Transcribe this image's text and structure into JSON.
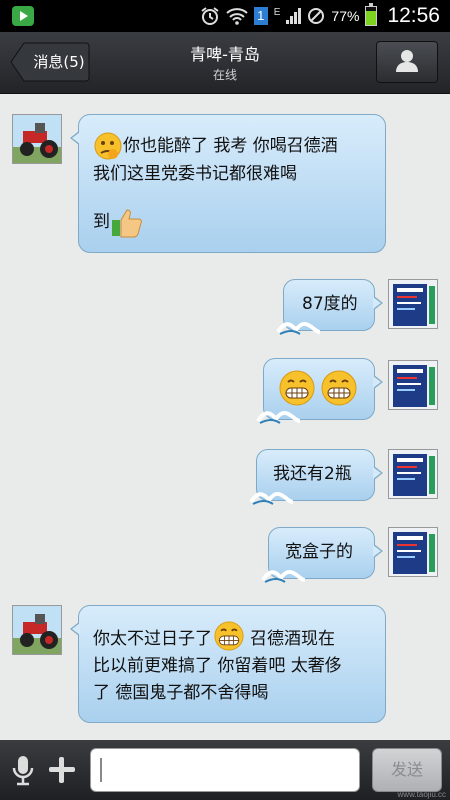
{
  "status_bar": {
    "sim_number": "1",
    "network_type": "E",
    "battery_percent": "77%",
    "battery_level": 0.77,
    "time": "12:56",
    "icons": [
      "app-play-icon",
      "alarm-icon",
      "wifi-icon",
      "sim-icon",
      "signal-icon",
      "no-sim-icon",
      "battery-icon"
    ]
  },
  "header": {
    "back_label": "消息(5)",
    "title": "青啤-青岛",
    "subtitle": "在线",
    "profile_icon": "person-icon"
  },
  "messages": [
    {
      "side": "left",
      "avatar": "tractor-avatar",
      "lines": [
        "你也能醉了 我考 你喝召德酒",
        "我们这里党委书记都很难喝",
        "",
        "到"
      ],
      "emoji": [
        "thinking-emoji",
        "thumbs-up-emoji"
      ]
    },
    {
      "side": "right",
      "avatar": "poster-avatar",
      "text": "87度的"
    },
    {
      "side": "right",
      "avatar": "poster-avatar",
      "text": "",
      "emoji": [
        "grin-emoji",
        "grin-emoji"
      ]
    },
    {
      "side": "right",
      "avatar": "poster-avatar",
      "text": "我还有2瓶"
    },
    {
      "side": "right",
      "avatar": "poster-avatar",
      "text": "宽盒子的"
    },
    {
      "side": "left",
      "avatar": "tractor-avatar",
      "line1_a": "你太不过日子了",
      "line1_b": "召德酒现在",
      "line2": "比以前更难搞了 你留着吧 太奢侈",
      "line3": "了 德国鬼子都不舍得喝",
      "emoji": [
        "grin-emoji"
      ]
    }
  ],
  "input_bar": {
    "input_value": "",
    "send_label": "发送",
    "icons": [
      "microphone-icon",
      "plus-icon"
    ]
  },
  "watermark": "www.taojiu.cc",
  "colors": {
    "bubble_top": "#d8ecfb",
    "bubble_bottom": "#a9d0ee",
    "bubble_border": "#7fa9c6",
    "chat_bg": "#e9ebea",
    "header": "#2c2e32"
  }
}
